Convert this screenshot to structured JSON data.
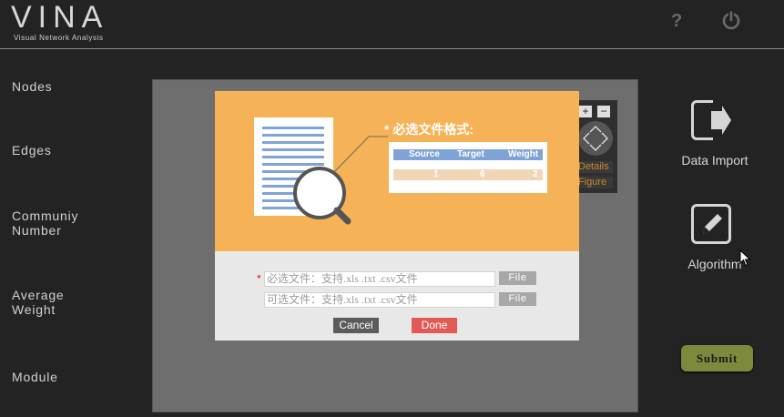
{
  "app": {
    "logo": "VINA",
    "subtitle": "Visual Network Analysis",
    "help_label": "?",
    "power_icon": "power-icon"
  },
  "stats": [
    {
      "label_line1": "Nodes",
      "label_line2": ""
    },
    {
      "label_line1": "Edges",
      "label_line2": ""
    },
    {
      "label_line1": "Communiy",
      "label_line2": "Number"
    },
    {
      "label_line1": "Average",
      "label_line2": "Weight"
    },
    {
      "label_line1": "Module",
      "label_line2": ""
    }
  ],
  "graph_controls": {
    "zoom_in": "+",
    "zoom_out": "−",
    "details_label": "Details",
    "figure_label": "Figure"
  },
  "sidebar": {
    "data_import_label": "Data Import",
    "algorithm_label": "Algorithm",
    "submit_label": "Submit"
  },
  "modal": {
    "format_title": "* 必选文件格式:",
    "sample_table": {
      "headers": [
        "Source",
        "Target",
        "Weight"
      ],
      "rows": [
        [
          "1",
          "6",
          "2"
        ]
      ]
    },
    "required_marker": "*",
    "required_placeholder": "必选文件：支持.xls .txt .csv文件",
    "optional_placeholder": "可选文件：支持.xls .txt .csv文件",
    "file_button_label": "File",
    "cancel_label": "Cancel",
    "done_label": "Done"
  },
  "colors": {
    "background": "#232323",
    "modal_header": "#f5b256",
    "table_blue": "#7fa3d6",
    "submit": "#7d8a3d",
    "done": "#e25a56",
    "cancel": "#5b5b5b"
  }
}
